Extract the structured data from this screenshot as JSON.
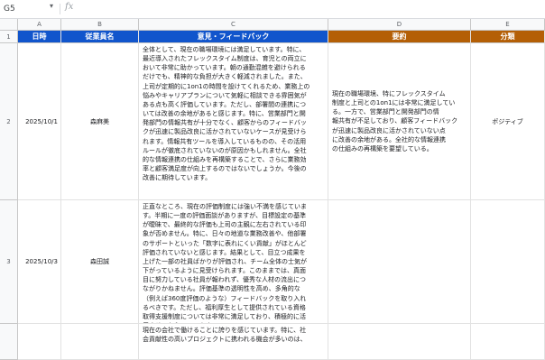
{
  "formula_bar": {
    "cell_ref": "G5",
    "fx_label": "fx",
    "formula_value": ""
  },
  "columns": {
    "A": "A",
    "B": "B",
    "C": "C",
    "D": "D",
    "E": "E"
  },
  "row_numbers": [
    "1",
    "2",
    "3"
  ],
  "headers": {
    "date": "日時",
    "employee": "従業員名",
    "feedback": "意見・フィードバック",
    "summary": "要約",
    "category": "分類"
  },
  "rows": [
    {
      "date": "2025/10/1",
      "employee": "森麻美",
      "feedback": "全体として、現在の職場環境には満足しています。特に、\n最近導入されたフレックスタイム制度は、育児との両立に\nおいて非常に助かっています。朝の通勤混雑を避けられる\nだけでも、精神的な負担が大きく軽減されました。また、\n上司が定期的に1on1の時間を設けてくれるため、業務上の\n悩みやキャリアプランについて気軽に相談できる雰囲気が\nある点も高く評価しています。ただし、部署間の連携につ\nいては改善の余地があると感じます。特に、営業部門と開\n発部門の情報共有が十分でなく、顧客からのフィードバッ\nクが迅速に製品改良に活かされていないケースが見受けら\nれます。情報共有ツールを導入しているものの、その活用\nルールが徹底されていないのが原因かもしれません。全社\n的な情報連携の仕組みを再構築することで、さらに業務効\n率と顧客満足度が向上するのではないでしょうか。今後の\n改善に期待しています。",
      "summary": "現在の職場環境、特にフレックスタイム\n制度と上司との1on1には非常に満足してい\nる。一方で、営業部門と開発部門の情\n報共有が不足しており、顧客フィードバック\nが迅速に製品改良に活かされていない点\nに改善の余地がある。全社的な情報連携\nの仕組みの再構築を要望している。",
      "category": "ポジティブ"
    },
    {
      "date": "2025/10/3",
      "employee": "森田誠",
      "feedback": "正直なところ、現在の評価制度には強い不満を感じていま\nす。半期に一度の評価面談がありますが、目標設定の基準\nが曖昧で、最終的な評価も上司の主観に左右されている印\n象が否めません。特に、日々の地道な業務改善や、他部署\nのサポートといった「数字に表れにくい貢献」がほとんど\n評価されていないと感じます。結果として、目立つ成果を\n上げた一部の社員ばかりが評価され、チーム全体の士気が\n下がっているように見受けられます。このままでは、真面\n目に努力している社員が報われず、優秀な人材の流出につ\nながりかねません。評価基準の透明性を高め、多角的な\n（例えば360度評価のような）フィードバックを取り入れ\nるべきです。ただし、福利厚生として提供されている資格\n取得支援制度については非常に満足しており、積極的に活\n用させてもらっています。",
      "summary": "",
      "category": ""
    },
    {
      "date": "",
      "employee": "",
      "feedback": "現在の会社で働けることに誇りを感じています。特に、社\n会貢献性の高いプロジェクトに携われる機会が多いのは、",
      "summary": "",
      "category": ""
    }
  ],
  "colors": {
    "header_blue": "#1155cc",
    "header_orange": "#b45f06",
    "selection": "#1a73e8"
  }
}
